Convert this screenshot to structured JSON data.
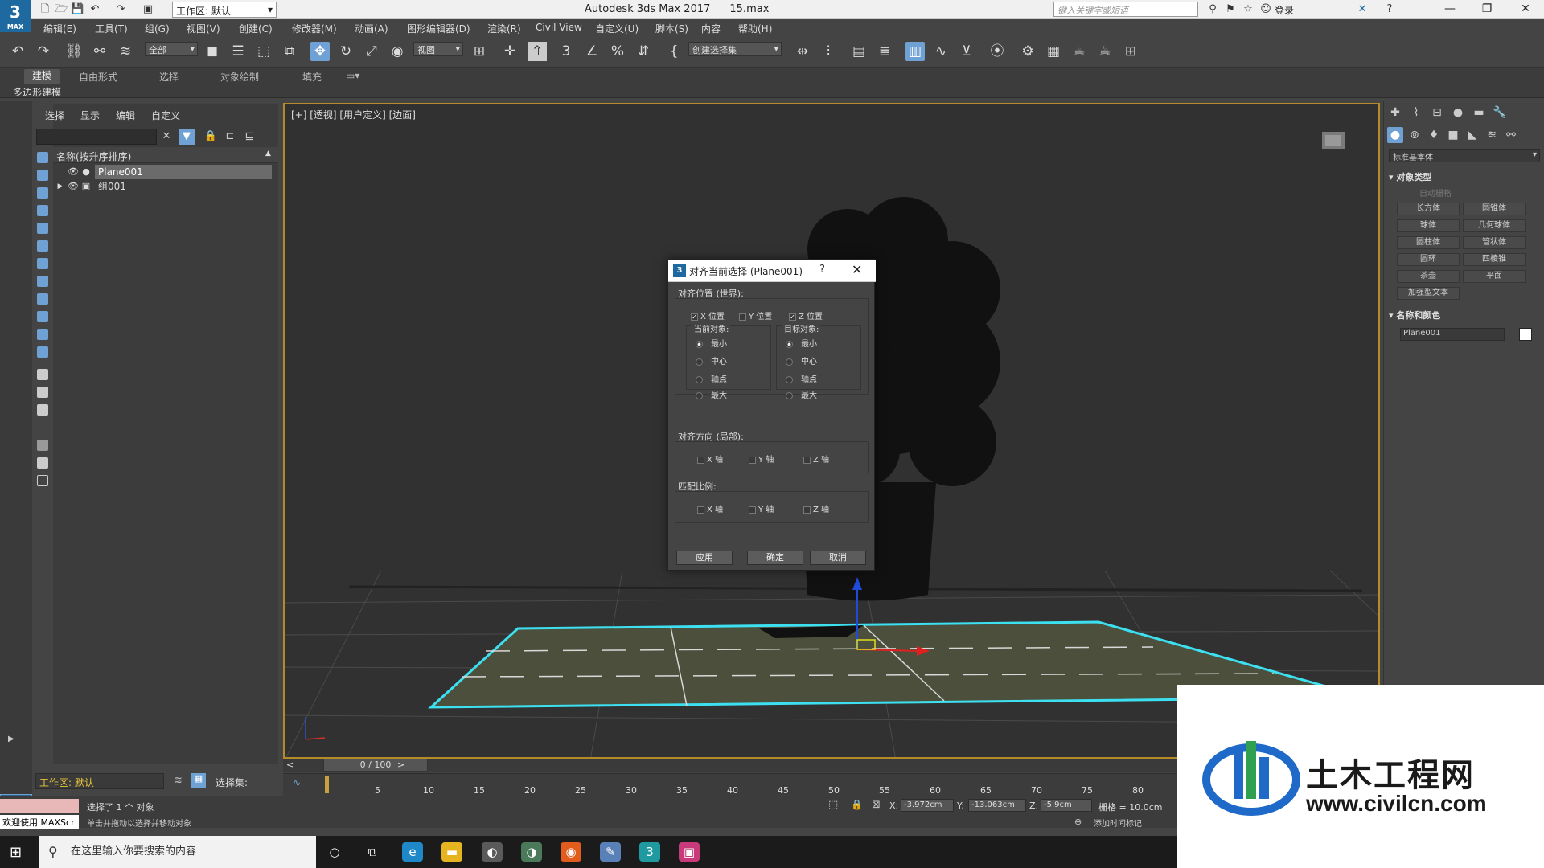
{
  "app": {
    "logo_text": "3",
    "logo_sub": "MAX",
    "title": "Autodesk 3ds Max 2017",
    "file": "15.max",
    "workspace_label": "工作区: 默认",
    "search_placeholder": "键入关键字或短语",
    "login_label": "登录"
  },
  "menu": [
    "编辑(E)",
    "工具(T)",
    "组(G)",
    "视图(V)",
    "创建(C)",
    "修改器(M)",
    "动画(A)",
    "图形编辑器(D)",
    "渲染(R)",
    "Civil View",
    "自定义(U)",
    "脚本(S)",
    "内容",
    "帮助(H)"
  ],
  "toolbar": {
    "filter_value": "全部",
    "refcoord_value": "视图",
    "selection_set_value": "创建选择集"
  },
  "ribbon": {
    "tabs": [
      "建模",
      "自由形式",
      "选择",
      "对象绘制",
      "填充"
    ],
    "active_tab": "建模",
    "sub_label": "多边形建模"
  },
  "explorer": {
    "tabs": [
      "选择",
      "显示",
      "编辑",
      "自定义"
    ],
    "column_header": "名称(按升序排序)",
    "rows": [
      {
        "name": "Plane001",
        "selected": true
      },
      {
        "name": "组001",
        "selected": false
      }
    ],
    "workspace_label": "工作区: 默认",
    "selection_set_label": "选择集:"
  },
  "viewport": {
    "label": "[+] [透视] [用户定义] [边面]"
  },
  "dialog": {
    "title": "对齐当前选择 (Plane001)",
    "help_label": "?",
    "group_position": "对齐位置 (世界):",
    "pos_x": {
      "label": "X 位置",
      "checked": true
    },
    "pos_y": {
      "label": "Y 位置",
      "checked": false
    },
    "pos_z": {
      "label": "Z 位置",
      "checked": true
    },
    "current_object_label": "当前对象:",
    "target_object_label": "目标对象:",
    "current_options": [
      {
        "label": "最小",
        "selected": true
      },
      {
        "label": "中心",
        "selected": false
      },
      {
        "label": "轴点",
        "selected": false
      },
      {
        "label": "最大",
        "selected": false
      }
    ],
    "target_options": [
      {
        "label": "最小",
        "selected": true
      },
      {
        "label": "中心",
        "selected": false
      },
      {
        "label": "轴点",
        "selected": false
      },
      {
        "label": "最大",
        "selected": false
      }
    ],
    "group_orientation": "对齐方向 (局部):",
    "orient_axes": [
      "X 轴",
      "Y 轴",
      "Z 轴"
    ],
    "group_scale": "匹配比例:",
    "scale_axes": [
      "X 轴",
      "Y 轴",
      "Z 轴"
    ],
    "btn_apply": "应用",
    "btn_ok": "确定",
    "btn_cancel": "取消"
  },
  "command_panel": {
    "category": "标准基本体",
    "object_type_title": "对象类型",
    "autogrid_label": "自动栅格",
    "buttons": [
      "长方体",
      "圆锥体",
      "球体",
      "几何球体",
      "圆柱体",
      "管状体",
      "圆环",
      "四棱锥",
      "茶壶",
      "平面",
      "加强型文本"
    ],
    "name_color_title": "名称和颜色",
    "name_value": "Plane001",
    "color": "#ffffff"
  },
  "timeline": {
    "frame_display": "0 / 100",
    "ticks": [
      "5",
      "10",
      "15",
      "20",
      "25",
      "30",
      "35",
      "40",
      "45",
      "50",
      "55",
      "60",
      "65",
      "70",
      "75",
      "80"
    ]
  },
  "status": {
    "selected_text": "选择了 1 个 对象",
    "hint_text": "单击并拖动以选择并移动对象",
    "welcome_text": "欢迎使用 MAXScr",
    "x_label": "X:",
    "x_value": "-3.972cm",
    "y_label": "Y:",
    "y_value": "-13.063cm",
    "z_label": "Z:",
    "z_value": "-5.9cm",
    "grid_text": "栅格 = 10.0cm",
    "add_time_tag": "添加时间标记"
  },
  "taskbar": {
    "search_placeholder": "在这里输入你要搜索的内容"
  },
  "watermark": {
    "cn_text": "土木工程网",
    "url": "www.civilcn.com"
  }
}
